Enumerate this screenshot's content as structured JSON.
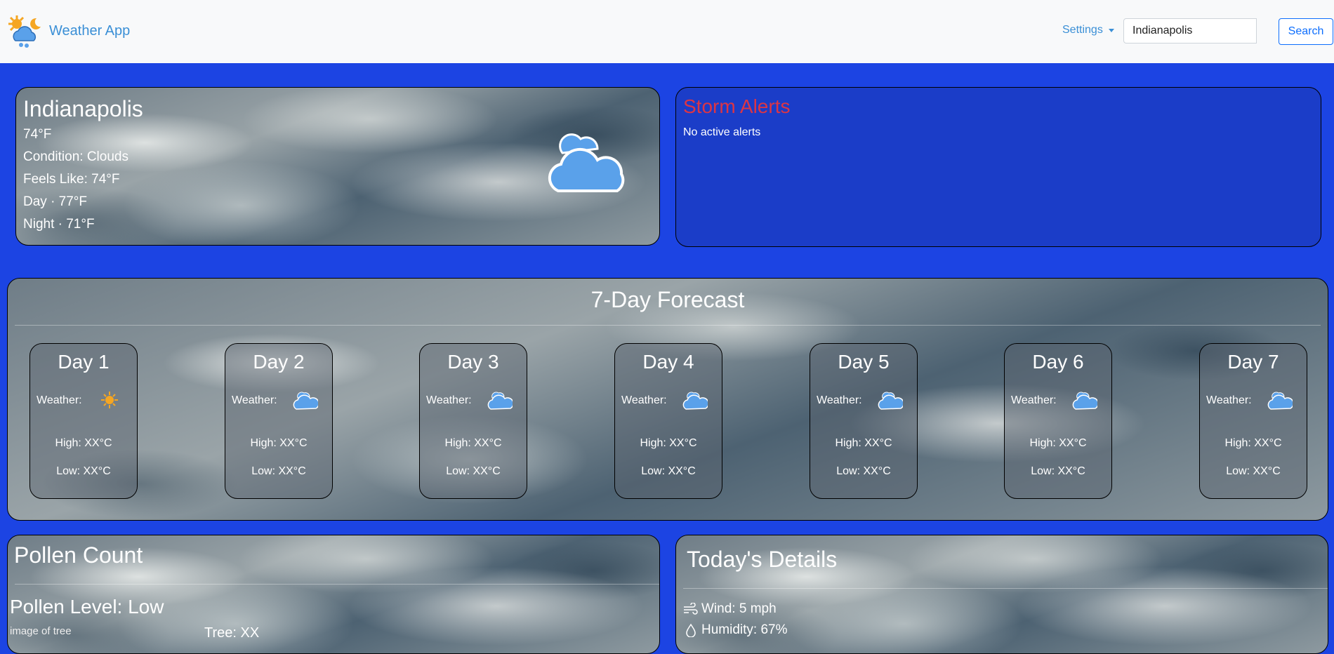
{
  "nav": {
    "brand": "Weather App",
    "settings_label": "Settings",
    "search_value": "Indianapolis",
    "search_button": "Search"
  },
  "current": {
    "city": "Indianapolis",
    "temp": "74°F",
    "condition": "Condition: Clouds",
    "feels_like": "Feels Like: 74°F",
    "day": "Day · 77°F",
    "night": "Night · 71°F",
    "icon": "cloud-icon"
  },
  "alerts": {
    "title": "Storm Alerts",
    "text": "No active alerts"
  },
  "forecast": {
    "title": "7-Day Forecast",
    "days": [
      {
        "title": "Day 1",
        "weather": "Weather:",
        "icon": "sun-icon",
        "high": "High: XX°C",
        "low": "Low: XX°C"
      },
      {
        "title": "Day 2",
        "weather": "Weather:",
        "icon": "cloud-icon",
        "high": "High: XX°C",
        "low": "Low: XX°C"
      },
      {
        "title": "Day 3",
        "weather": "Weather:",
        "icon": "cloud-icon",
        "high": "High: XX°C",
        "low": "Low: XX°C"
      },
      {
        "title": "Day 4",
        "weather": "Weather:",
        "icon": "cloud-icon",
        "high": "High: XX°C",
        "low": "Low: XX°C"
      },
      {
        "title": "Day 5",
        "weather": "Weather:",
        "icon": "cloud-icon",
        "high": "High: XX°C",
        "low": "Low: XX°C"
      },
      {
        "title": "Day 6",
        "weather": "Weather:",
        "icon": "cloud-icon",
        "high": "High: XX°C",
        "low": "Low: XX°C"
      },
      {
        "title": "Day 7",
        "weather": "Weather:",
        "icon": "cloud-icon",
        "high": "High: XX°C",
        "low": "Low: XX°C"
      }
    ]
  },
  "pollen": {
    "title": "Pollen Count",
    "level": "Pollen Level: Low",
    "tree_img_alt": "image of tree",
    "tree": "Tree: XX"
  },
  "details": {
    "title": "Today's Details",
    "wind": "Wind: 5 mph",
    "humidity": "Humidity: 67%"
  },
  "colors": {
    "page_bg": "#1c44e3",
    "alerts_bg": "#1b3dc8",
    "alert_title": "#dc3545",
    "brand": "#3a8fd6",
    "cloud": "#5aa1ea"
  }
}
